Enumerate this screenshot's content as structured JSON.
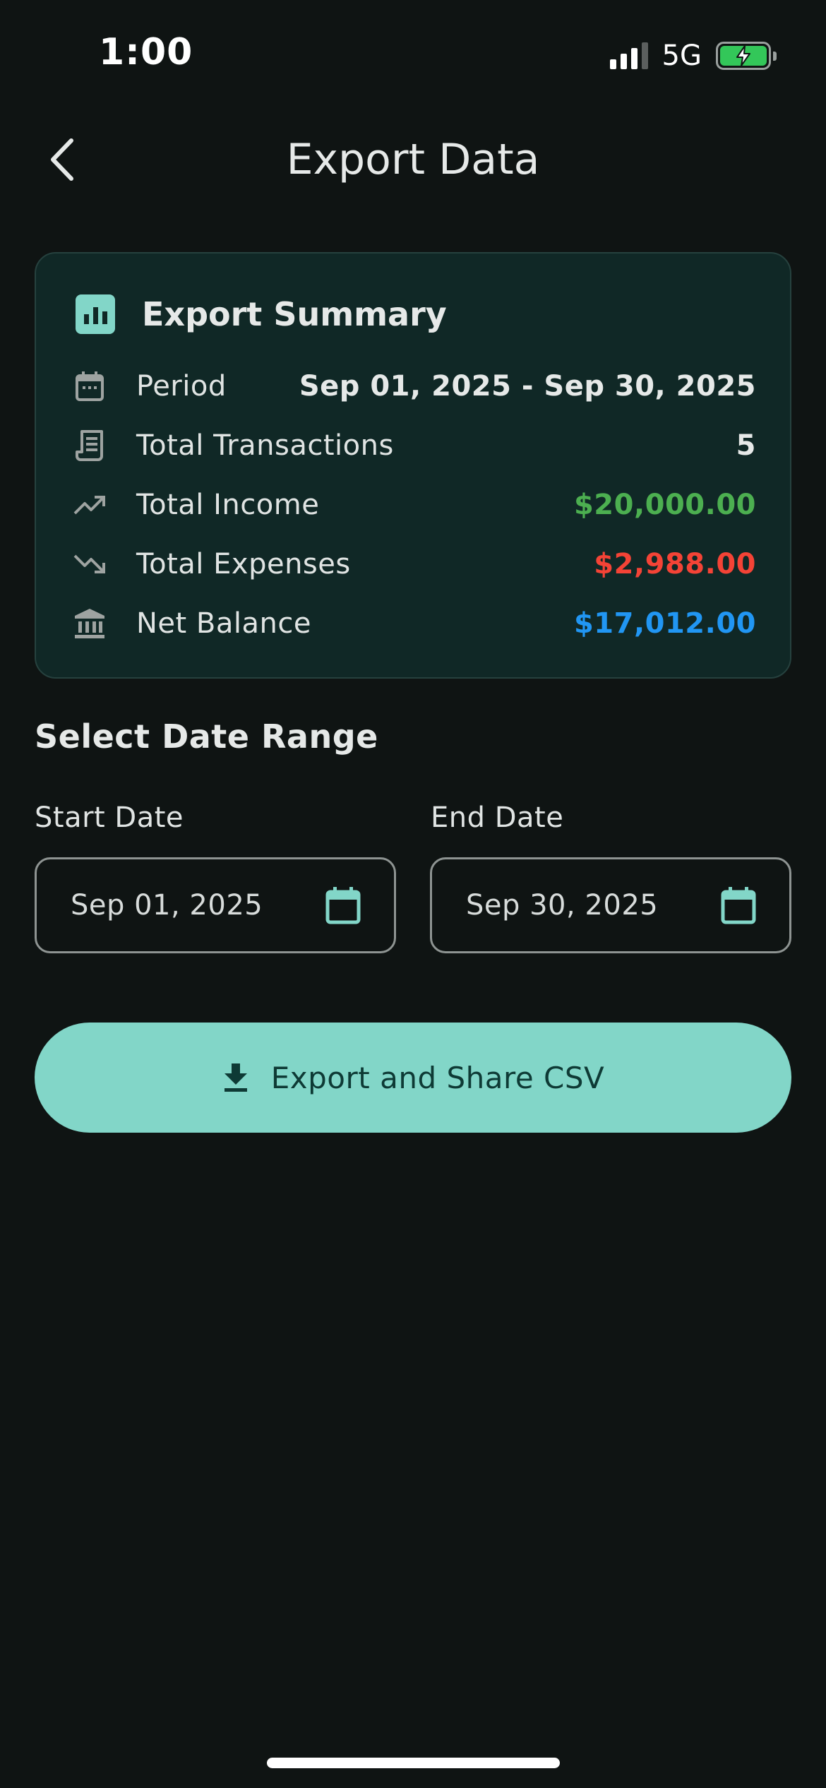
{
  "status_bar": {
    "time": "1:00",
    "network": "5G"
  },
  "header": {
    "title": "Export Data"
  },
  "summary": {
    "title": "Export Summary",
    "rows": [
      {
        "icon": "calendar-icon",
        "label": "Period",
        "value": "Sep 01, 2025 - Sep 30, 2025",
        "color": "#e6e9e8"
      },
      {
        "icon": "receipt-icon",
        "label": "Total Transactions",
        "value": "5",
        "color": "#e6e9e8"
      },
      {
        "icon": "trending-up-icon",
        "label": "Total Income",
        "value": "$20,000.00",
        "color": "#4caf50"
      },
      {
        "icon": "trending-down-icon",
        "label": "Total Expenses",
        "value": "$2,988.00",
        "color": "#f44336"
      },
      {
        "icon": "bank-icon",
        "label": "Net Balance",
        "value": "$17,012.00",
        "color": "#2196f3"
      }
    ]
  },
  "date_range": {
    "section_title": "Select Date Range",
    "start": {
      "label": "Start Date",
      "value": "Sep 01, 2025"
    },
    "end": {
      "label": "End Date",
      "value": "Sep 30, 2025"
    }
  },
  "export_button": {
    "label": "Export and Share CSV"
  },
  "colors": {
    "accent": "#82d6c8",
    "background": "#0f1413",
    "card": "#102826",
    "income": "#4caf50",
    "expense": "#f44336",
    "balance": "#2196f3"
  }
}
